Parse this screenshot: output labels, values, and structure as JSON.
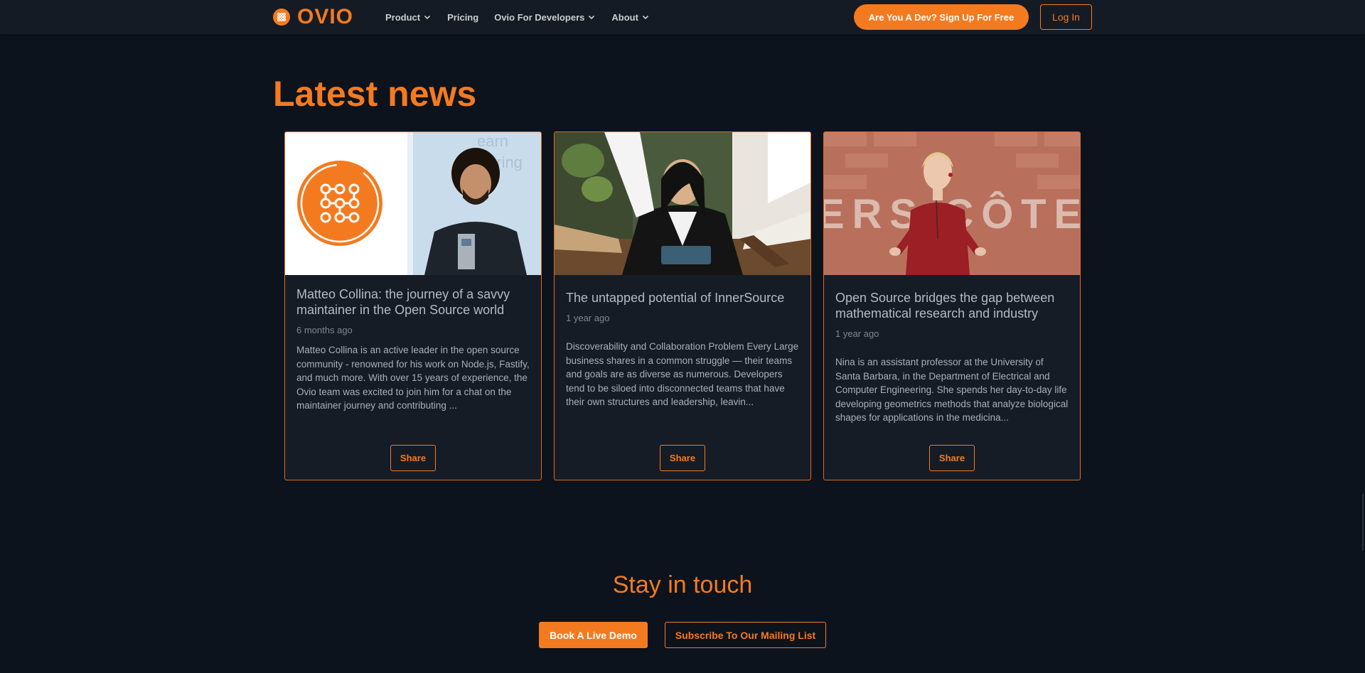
{
  "nav": {
    "brand": "OVIO",
    "brand_icon": "ovio-logo-icon",
    "items": [
      {
        "label": "Product",
        "has_dropdown": true
      },
      {
        "label": "Pricing",
        "has_dropdown": false
      },
      {
        "label": "Ovio For Developers",
        "has_dropdown": true
      },
      {
        "label": "About",
        "has_dropdown": true
      }
    ],
    "cta_label": "Are You A Dev? Sign Up For Free",
    "login_label": "Log In"
  },
  "news": {
    "title": "Latest news",
    "share_label": "Share",
    "cards": [
      {
        "title": "Matteo Collina: the journey of a savvy maintainer in the Open Source world",
        "date": "6 months ago",
        "excerpt": "Matteo Collina is an active leader in the open source community - renowned for his work on Node.js, Fastify, and much more. With over 15 years of experience, the Ovio team was excited to join him for a chat on the maintainer journey and contributing ...",
        "image": "ovio-logo-and-speaker-photo"
      },
      {
        "title": "The untapped potential of InnerSource",
        "date": "1 year ago",
        "excerpt": "Discoverability and Collaboration Problem Every Large business shares in a common struggle — their teams and goals are as diverse as numerous. Developers tend to be siloed into disconnected teams that have their own structures and leadership, leavin...",
        "image": "team-pointing-at-tablet-photo"
      },
      {
        "title": "Open Source bridges the gap between mathematical research and industry",
        "date": "1 year ago",
        "excerpt": "Nina is an assistant professor at the University of Santa Barbara, in the Department of Electrical and Computer Engineering. She spends her day-to-day life developing geometrics methods that analyze biological shapes for applications in the medicina...",
        "image": "speaker-on-stage-photo",
        "backdrop_text": "ERS  CÔTE"
      }
    ]
  },
  "touch": {
    "title": "Stay in touch",
    "demo_label": "Book A Live Demo",
    "subscribe_label": "Subscribe To Our Mailing List"
  },
  "colors": {
    "accent": "#f47a20",
    "background": "#0d131c",
    "nav_bg": "#151b24",
    "card_bg": "#161c26"
  }
}
